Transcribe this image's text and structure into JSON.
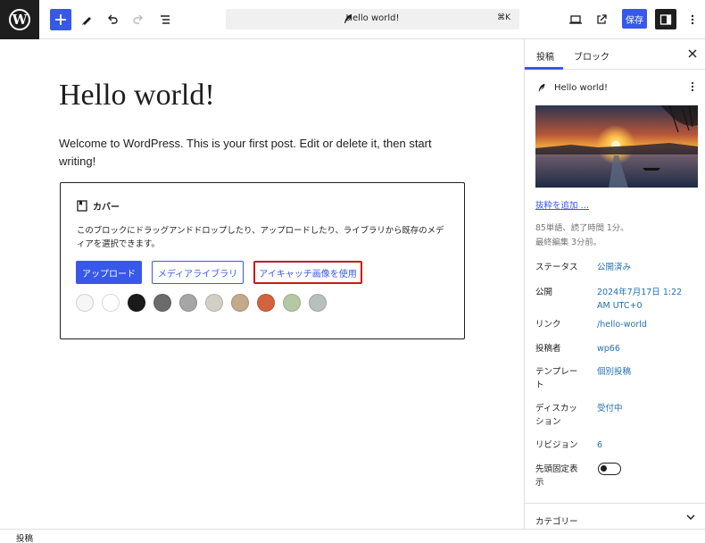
{
  "toolbar": {
    "logo_letter": "W",
    "command_title": "Hello world!",
    "command_shortcut": "⌘K",
    "save_label": "保存"
  },
  "editor": {
    "title": "Hello world!",
    "paragraph": "Welcome to WordPress. This is your first post. Edit or delete it, then start writing!",
    "cover": {
      "heading": "カバー",
      "description": "このブロックにドラッグアンドドロップしたり、アップロードしたり、ライブラリから既存のメディアを選択できます。",
      "upload_label": "アップロード",
      "media_label": "メディアライブラリ",
      "featured_label": "アイキャッチ画像を使用",
      "swatch_colors": [
        "#f6f6f6",
        "#ffffff",
        "#1a1a1a",
        "#6b6b6b",
        "#a6a6a6",
        "#d4cfc4",
        "#c4a98c",
        "#d1643e",
        "#b5c7a3",
        "#b9bfbf"
      ]
    }
  },
  "sidebar": {
    "tab_post": "投稿",
    "tab_block": "ブロック",
    "post_title": "Hello world!",
    "excerpt_link": "抜粋を追加 …",
    "meta_line1": "85単語、読了時間 1分。",
    "meta_line2": "最終編集 3分前。",
    "rows": [
      {
        "label": "ステータス",
        "value": "公開済み"
      },
      {
        "label": "公開",
        "value": "2024年7月17日 1:22 AM UTC+0"
      },
      {
        "label": "リンク",
        "value": "/hello-world"
      },
      {
        "label": "投稿者",
        "value": "wp66"
      },
      {
        "label": "テンプレート",
        "value": "個別投稿"
      },
      {
        "label": "ディスカッション",
        "value": "受付中"
      },
      {
        "label": "リビジョン",
        "value": "6"
      },
      {
        "label": "先頭固定表示",
        "value": ""
      }
    ],
    "category_label": "カテゴリー"
  },
  "footer": {
    "breadcrumb": "投稿"
  }
}
